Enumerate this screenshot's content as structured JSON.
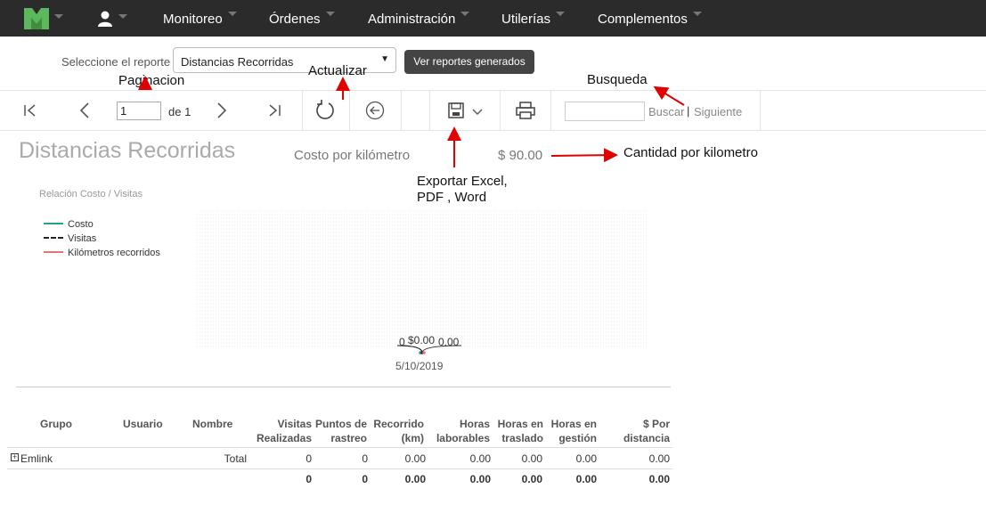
{
  "nav": {
    "items": [
      {
        "label": "Monitoreo"
      },
      {
        "label": "Órdenes"
      },
      {
        "label": "Administración"
      },
      {
        "label": "Utilerías"
      },
      {
        "label": "Complementos"
      }
    ],
    "colors": {
      "background": "#2b2b2b",
      "logo": "#5cb85c"
    }
  },
  "report_selector": {
    "label": "Seleccione el reporte",
    "selected": "Distancias Recorridas",
    "generated_button": "Ver reportes generados"
  },
  "toolbar": {
    "page_current": "1",
    "page_of": "de 1",
    "search_link": "Buscar",
    "search_separator": "|",
    "next_link": "Siguiente"
  },
  "report": {
    "title": "Distancias Recorridas",
    "cost_label": "Costo por kilómetro",
    "cost_value": "$ 90.00"
  },
  "chart_data": {
    "type": "line",
    "title": "Relación Costo / Visitas",
    "x": [
      "5/10/2019"
    ],
    "series": [
      {
        "name": "Costo",
        "values": [
          0
        ],
        "label": "$0.00",
        "color": "#1fa38f"
      },
      {
        "name": "Visitas",
        "values": [
          0
        ],
        "label": "0",
        "color": "#222222"
      },
      {
        "name": "Kilómetros recorridos",
        "values": [
          0
        ],
        "label": "0.00",
        "color": "#e57373"
      }
    ],
    "legend": "left",
    "grid": true
  },
  "table": {
    "headers": [
      [
        "Grupo"
      ],
      [
        "Usuario"
      ],
      [
        "Nombre"
      ],
      [
        "Visitas",
        "Realizadas"
      ],
      [
        "Puntos de",
        "rastreo"
      ],
      [
        "Recorrido",
        "(km)"
      ],
      [
        "Horas",
        "laborables"
      ],
      [
        "Horas en",
        "traslado"
      ],
      [
        "Horas en",
        "gestión"
      ],
      [
        "$ Por",
        "distancia"
      ]
    ],
    "rows": [
      {
        "group": "Emlink",
        "name": "Total",
        "visitas": "0",
        "puntos": "0",
        "recorrido": "0.00",
        "horas_lab": "0.00",
        "horas_tras": "0.00",
        "horas_gest": "0.00",
        "por_distancia": "0.00"
      }
    ],
    "totals": {
      "visitas": "0",
      "puntos": "0",
      "recorrido": "0.00",
      "horas_lab": "0.00",
      "horas_tras": "0.00",
      "horas_gest": "0.00",
      "por_distancia": "0.00"
    }
  },
  "annotations": {
    "paginacion": "Paginacion",
    "actualizar": "Actualizar",
    "busqueda": "Busqueda",
    "cantidad": "Cantidad por kilometro",
    "exportar_line1": "Exportar Excel,",
    "exportar_line2": "PDF , Word",
    "arrow_color": "#e00000"
  }
}
